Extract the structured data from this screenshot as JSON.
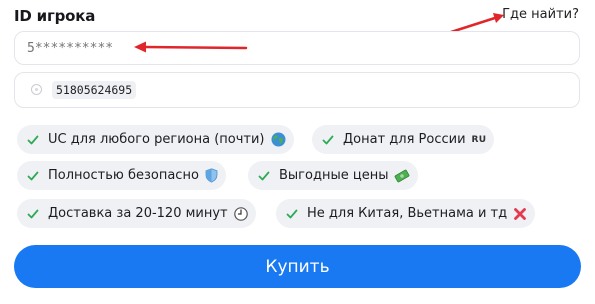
{
  "form": {
    "id_label": "ID игрока",
    "help_link": "Где найти?",
    "id_placeholder": "5**********",
    "id_value": "",
    "saved_id": "51805624695"
  },
  "features": [
    {
      "label": "UC для любого региона (почти)",
      "icon": "globe-icon"
    },
    {
      "label": "Донат для России",
      "icon": "ru-flag-icon",
      "mark": "RU"
    },
    {
      "label": "Полностью безопасно",
      "icon": "shield-icon"
    },
    {
      "label": "Выгодные цены",
      "icon": "money-icon"
    },
    {
      "label": "Доставка за 20-120 минут",
      "icon": "clock-icon"
    },
    {
      "label": "Не для Китая, Вьетнама и тд",
      "icon": "cross-icon"
    }
  ],
  "buy_button": {
    "label": "Купить"
  },
  "colors": {
    "accent": "#1879f3",
    "check": "#2eaa57",
    "arrow": "#e0262b",
    "tag_bg": "#eff1f4",
    "border": "#e3e5ea"
  }
}
